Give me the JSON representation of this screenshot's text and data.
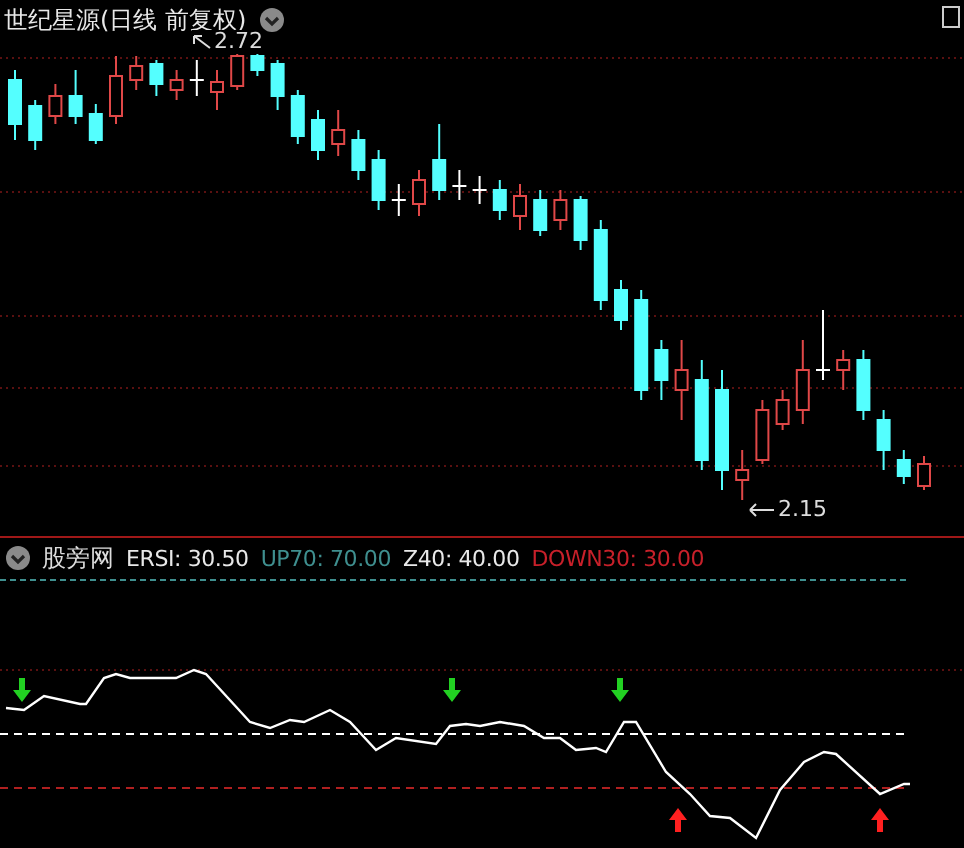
{
  "chart": {
    "title": "世纪星源(日线 前复权)",
    "high_label": "2.72",
    "low_label": "2.15"
  },
  "indicator": {
    "name": "股旁网",
    "legend": [
      {
        "text": "ERSI: 30.50",
        "color": "#e8e8e8"
      },
      {
        "text": "UP70: 70.00",
        "color": "#3f8f8f"
      },
      {
        "text": "Z40: 40.00",
        "color": "#e8e8e8"
      },
      {
        "text": "DOWN30: 30.00",
        "color": "#c8202a"
      }
    ]
  }
}
